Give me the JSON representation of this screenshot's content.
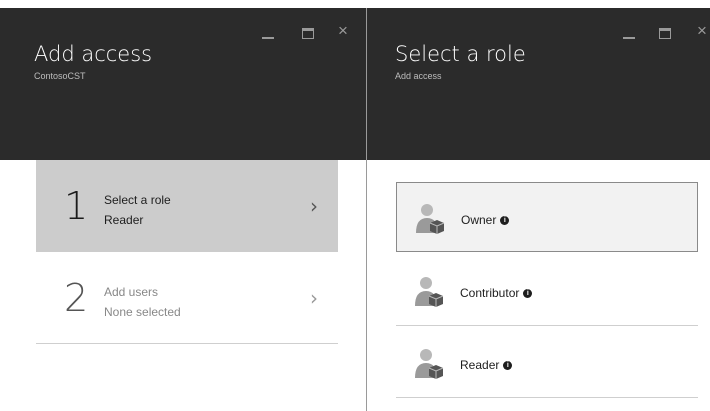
{
  "left_blade": {
    "title": "Add access",
    "subtitle": "ContosoCST",
    "steps": [
      {
        "number": "1",
        "title": "Select a role",
        "value": "Reader",
        "active": true
      },
      {
        "number": "2",
        "title": "Add users",
        "value": "None selected",
        "active": false
      }
    ]
  },
  "right_blade": {
    "title": "Select a role",
    "subtitle": "Add access",
    "roles": [
      {
        "label": "Owner",
        "selected": true
      },
      {
        "label": "Contributor",
        "selected": false
      },
      {
        "label": "Reader",
        "selected": false
      }
    ]
  },
  "window_controls": {
    "close_glyph": "×"
  },
  "colors": {
    "header": "#2b2b2b",
    "active_step": "#cccccc"
  }
}
